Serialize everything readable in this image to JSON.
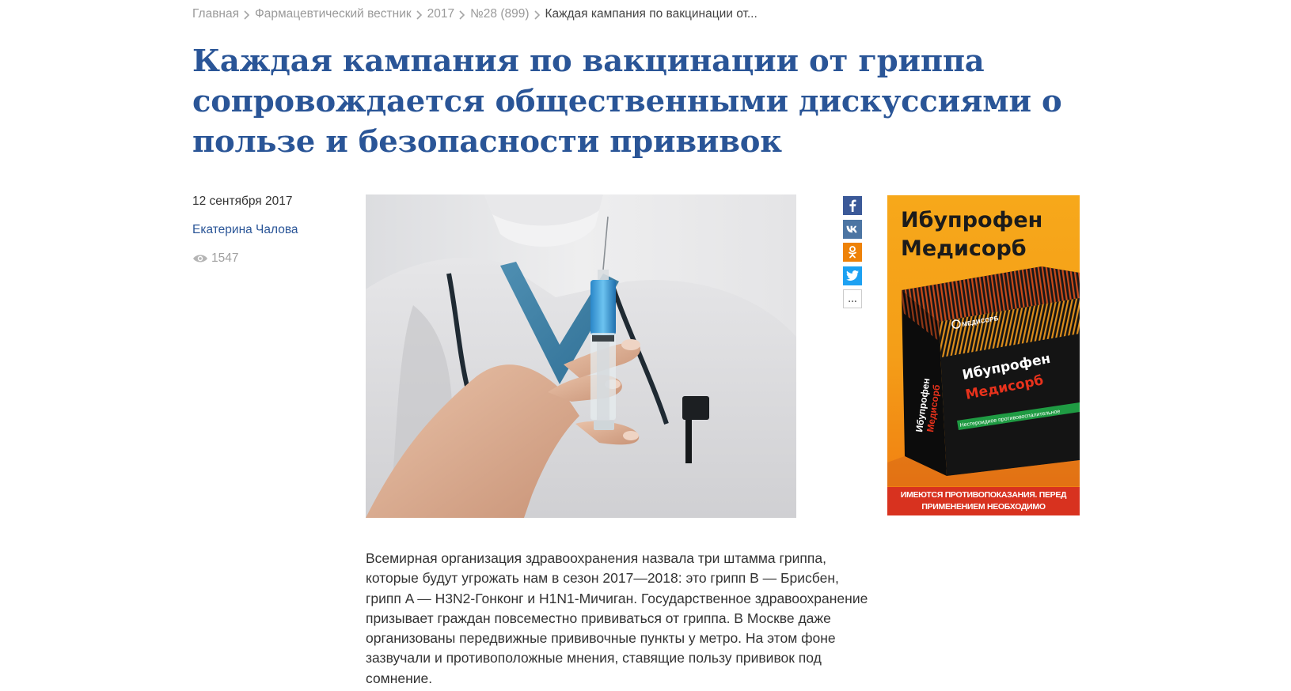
{
  "breadcrumb": {
    "items": [
      "Главная",
      "Фармацевтический вестник",
      "2017",
      "№28 (899)"
    ],
    "current": "Каждая кампания по вакцинации от..."
  },
  "article": {
    "title": "Каждая кампания по вакцинации от гриппа сопровождается общественными дискуссиями о пользе и безопасности прививок",
    "date": "12 сентября 2017",
    "author": "Екатерина Чалова",
    "views": "1547",
    "body": "Всемирная организация здравоохранения назвала три штамма гриппа, которые будут угрожать нам в сезон 2017—2018: это грипп B — Брисбен, грипп A — H3N2-Гонконг и H1N1-Мичиган. Государственное здравоохранение призывает граждан повсеместно прививаться от гриппа. В Москве даже организованы передвижные прививочные пункты у метро. На этом фоне зазвучали и противоположные мнения, ставящие пользу прививок под сомнение."
  },
  "share": {
    "buttons": [
      {
        "name": "facebook",
        "glyph": "f",
        "color": "#3b5998"
      },
      {
        "name": "vkontakte",
        "glyph": "vk",
        "color": "#4c75a3"
      },
      {
        "name": "odnoklassniki",
        "glyph": "ok",
        "color": "#ee8208"
      },
      {
        "name": "twitter",
        "glyph": "twitter-bird",
        "color": "#1da1f2"
      },
      {
        "name": "more",
        "glyph": "…",
        "color": "#ffffff"
      }
    ]
  },
  "ad": {
    "title": "Ибупрофен Медисорб",
    "brand": "МЕДИСОРБ",
    "box_line1": "Ибупрофен",
    "box_line2": "Медисорб",
    "box_side": "Ибупрофен Медисорб",
    "box_strip": "Нестероидное противовоспалительное",
    "disclaimer": "ИМЕЮТСЯ ПРОТИВОПОКАЗАНИЯ. ПЕРЕД ПРИМЕНЕНИЕМ НЕОБХОДИМО ПРОКОНСУЛЬТИРОВАТЬСЯ СО СПЕЦИАЛИСТОМ."
  },
  "colors": {
    "title": "#2a5597",
    "link": "#2a5597",
    "muted": "#9a9a9a",
    "ad_orange": "#f7a81a",
    "ad_red": "#d8321f"
  }
}
